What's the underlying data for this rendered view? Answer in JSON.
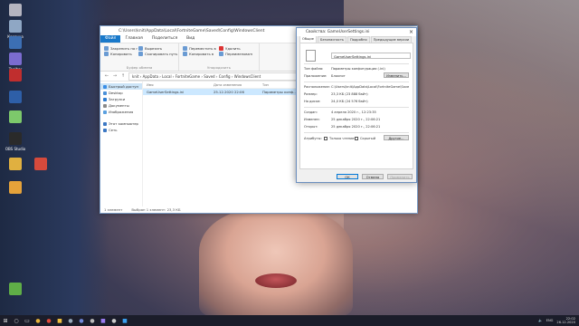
{
  "desktop": {
    "icons": [
      {
        "label": "",
        "color": "#b5b5c0"
      },
      {
        "label": "Корзина",
        "color": "#8fa7c4"
      },
      {
        "label": "",
        "color": "#3c6fb4"
      },
      {
        "label": "Toolbar",
        "color": "#7b6cd0"
      },
      {
        "label": "",
        "color": "#c02e2e"
      },
      {
        "label": "",
        "color": "#2e5fa8"
      },
      {
        "label": "",
        "color": "#7dc96b"
      },
      {
        "label": "OBS Studio",
        "color": "#2a2a2a"
      },
      {
        "label": "",
        "color": "#e0b040"
      },
      {
        "label": "",
        "color": "#d54a3c"
      },
      {
        "label": "",
        "color": "#e5a23a"
      },
      {
        "label": "",
        "color": "#5fae47"
      }
    ]
  },
  "explorer": {
    "title": "C:\\Users\\knit\\AppData\\Local\\FortniteGame\\Saved\\Config\\WindowsClient",
    "tabs": {
      "file": "Файл",
      "home": "Главная",
      "share": "Поделиться",
      "view": "Вид"
    },
    "ribbon": {
      "pin_label": "Закрепить на панели быстрого доступа",
      "copy_label": "Копировать",
      "paste_label": "Вставить",
      "cut_label": "Вырезать",
      "copy_path_label": "Скопировать путь",
      "paste_shortcut_label": "Вставить ярлык",
      "move_label": "Переместить в",
      "copy_to_label": "Копировать в",
      "delete_label": "Удалить",
      "rename_label": "Переименовать",
      "clipboard_group": "Буфер обмена",
      "organize_group": "Упорядочить"
    },
    "address": "knit › AppData › Local › FortniteGame › Saved › Config › WindowsClient",
    "nav": {
      "quick_access": "Быстрый доступ",
      "desktop": "Desktop",
      "downloads": "Загрузки",
      "documents": "Документы",
      "images": "Изображения",
      "onedrive": "Этот компьютер",
      "network": "Сеть"
    },
    "columns": {
      "name": "Имя",
      "date": "Дата изменения",
      "type": "Тип",
      "size": "Размер"
    },
    "files": [
      {
        "name": "GameUserSettings.ini",
        "date": "25.12.2020 22:06",
        "type": "Параметры конф...",
        "size": ""
      }
    ],
    "status": {
      "count": "1 элемент",
      "selected": "Выбран 1 элемент: 23,3 КБ"
    }
  },
  "properties": {
    "title": "Свойства: GameUserSettings.ini",
    "tabs": [
      "Общие",
      "Безопасность",
      "Подробно",
      "Предыдущие версии"
    ],
    "filename": "GameUserSettings.ini",
    "type_label": "Тип файла:",
    "type_value": "Параметры конфигурации (.ini)",
    "app_label": "Приложение:",
    "app_value": "Блокнот",
    "change_btn": "Изменить...",
    "location_label": "Расположение:",
    "location_value": "C:\\Users\\knit\\AppData\\Local\\FortniteGame\\Saved\\",
    "size_label": "Размер:",
    "size_value": "23,3 КБ (23 888 байт)",
    "disk_label": "На диске:",
    "disk_value": "24,0 КБ (24 576 байт)",
    "created_label": "Создан:",
    "created_value": "4 апреля 2020 г., 12:23:35",
    "modified_label": "Изменен:",
    "modified_value": "25 декабря 2020 г., 22:06:21",
    "opened_label": "Открыт:",
    "opened_value": "25 декабря 2020 г., 22:06:21",
    "attrs_label": "Атрибуты:",
    "readonly_label": "Только чтение",
    "hidden_label": "Скрытый",
    "other_btn": "Другие...",
    "ok_btn": "ОК",
    "cancel_btn": "Отмена",
    "apply_btn": "Применить"
  },
  "taskbar": {
    "lang": "ENG",
    "time": "22:02",
    "date": "26.12.2020"
  }
}
